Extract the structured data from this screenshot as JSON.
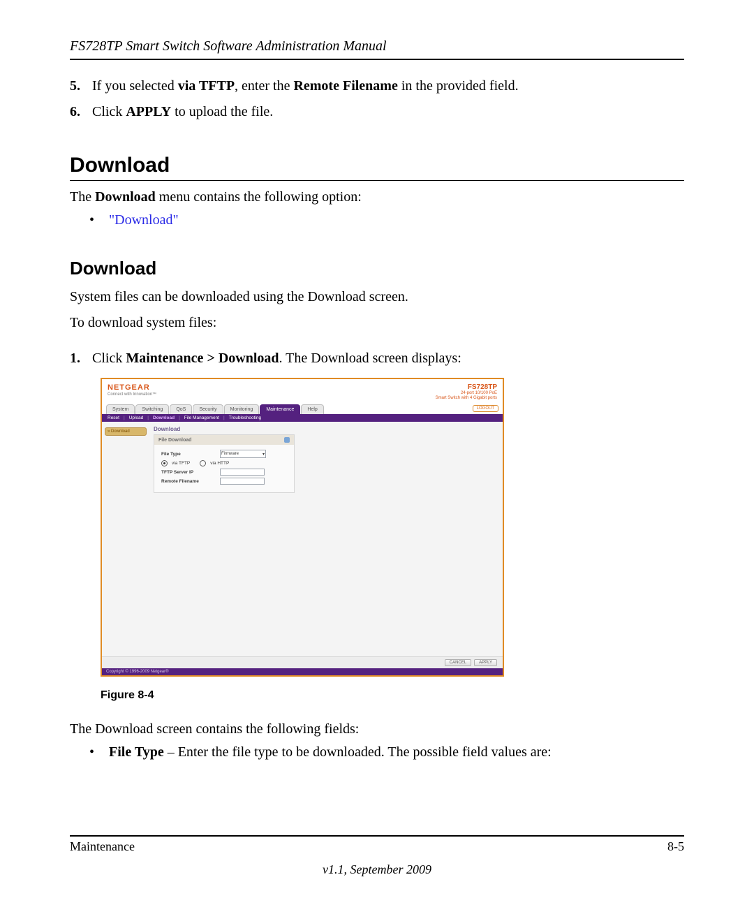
{
  "header": {
    "running_head": "FS728TP Smart Switch Software Administration Manual"
  },
  "steps_top": [
    {
      "num": "5.",
      "pre": "If you selected ",
      "b1": "via TFTP",
      "mid": ", enter the ",
      "b2": "Remote Filename",
      "post": " in the provided field."
    },
    {
      "num": "6.",
      "pre": "Click ",
      "b1": "APPLY",
      "post": " to upload the file."
    }
  ],
  "h1_download": "Download",
  "download_intro_pre": "The ",
  "download_intro_bold": "Download",
  "download_intro_post": " menu contains the following option:",
  "download_link": "\"Download\"",
  "h2_download": "Download",
  "p_sysfiles": "System files can be downloaded using the Download screen.",
  "p_todownload": "To download system files:",
  "step1": {
    "num": "1.",
    "pre": "Click ",
    "b1": "Maintenance > Download",
    "post": ". The Download screen displays:"
  },
  "figure_label": "Figure 8-4",
  "p_after_fig": "The Download screen contains the following fields:",
  "field_li": {
    "b": "File Type",
    "rest": " – Enter the file type to be downloaded. The possible field values are:"
  },
  "footer": {
    "section": "Maintenance",
    "pagenum": "8-5",
    "version": "v1.1, September 2009"
  },
  "screenshot": {
    "brand": "NETGEAR",
    "tagline": "Connect with Innovation™",
    "model": "FS728TP",
    "model_sub1": "24-port 10/100 PoE",
    "model_sub2": "Smart Switch with 4 Gigabit ports",
    "tabs": [
      "System",
      "Switching",
      "QoS",
      "Security",
      "Monitoring",
      "Maintenance",
      "Help"
    ],
    "active_tab_index": 5,
    "logout": "LOGOUT",
    "subnav": [
      "Reset",
      "Upload",
      "Download",
      "File Management",
      "Troubleshooting"
    ],
    "subnav_active_index": 2,
    "side_item": "» Download",
    "panel_title_outer": "Download",
    "panel_title_inner": "File Download",
    "rows": {
      "file_type_label": "File Type",
      "file_type_value": "Firmware",
      "via_tftp": "via TFTP",
      "via_http": "via HTTP",
      "tftp_ip": "TFTP Server IP",
      "remote_filename": "Remote Filename"
    },
    "buttons": {
      "cancel": "CANCEL",
      "apply": "APPLY"
    },
    "copyright": "Copyright © 1996-2009 Netgear®"
  }
}
